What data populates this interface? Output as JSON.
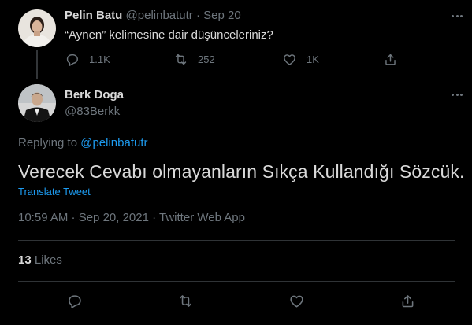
{
  "parent_tweet": {
    "author_name": "Pelin Batu",
    "handle": "@pelinbatutr",
    "separator": "·",
    "date": "Sep 20",
    "text": "“Aynen” kelimesine dair düşünceleriniz?",
    "actions": {
      "reply_count": "1.1K",
      "retweet_count": "252",
      "like_count": "1K"
    }
  },
  "main_tweet": {
    "author_name": "Berk Doga",
    "handle": "@83Berkk",
    "replying_prefix": "Replying to ",
    "replying_to": "@pelinbatutr",
    "text": "Verecek Cevabı olmayanların Sıkça Kullandığı Sözcük.",
    "translate_label": "Translate Tweet",
    "timestamp": "10:59 AM · Sep 20, 2021 · Twitter Web App",
    "likes_count": "13",
    "likes_label": "Likes"
  },
  "icons": {
    "reply": "reply-icon",
    "retweet": "retweet-icon",
    "like": "heart-icon",
    "share": "share-icon",
    "more": "more-icon"
  },
  "colors": {
    "background": "#000000",
    "text": "#d9d9d9",
    "secondary": "#6e767d",
    "link": "#1d9bf0",
    "divider": "#2f3336"
  }
}
